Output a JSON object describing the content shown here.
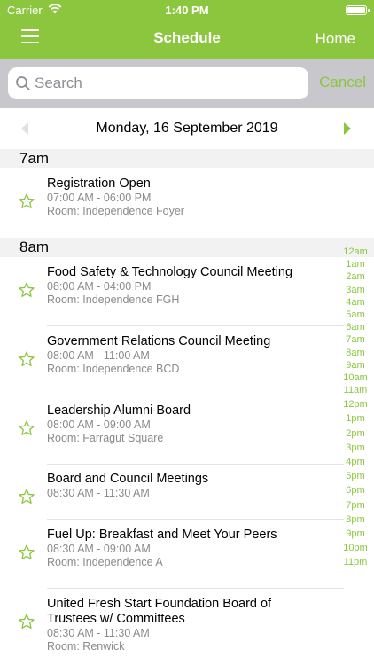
{
  "status_bar": {
    "carrier": "Carrier",
    "time": "1:40 PM"
  },
  "header": {
    "title": "Schedule",
    "home_label": "Home"
  },
  "search": {
    "placeholder": "Search",
    "cancel_label": "Cancel"
  },
  "date_nav": {
    "date": "Monday, 16 September 2019"
  },
  "sections": [
    {
      "label": "7am",
      "events": [
        {
          "title": "Registration Open",
          "time": "07:00 AM - 06:00 PM",
          "room": "Room: Independence Foyer"
        }
      ]
    },
    {
      "label": "8am",
      "events": [
        {
          "title": "Food Safety & Technology Council Meeting",
          "time": "08:00 AM - 04:00 PM",
          "room": "Room: Independence FGH"
        },
        {
          "title": "Government Relations Council Meeting",
          "time": "08:00 AM - 11:00 AM",
          "room": "Room: Independence BCD"
        },
        {
          "title": "Leadership Alumni Board",
          "time": "08:00 AM - 09:00 AM",
          "room": "Room: Farragut Square"
        },
        {
          "title": "Board and Council Meetings",
          "time": "08:30 AM - 11:30 AM",
          "room": ""
        },
        {
          "title": "Fuel Up: Breakfast and Meet Your Peers",
          "time": "08:30 AM - 09:00 AM",
          "room": "Room: Independence A"
        },
        {
          "title_line1": "United Fresh Start Foundation Board of",
          "title_line2": "Trustees w/ Committees",
          "time": "08:30 AM - 11:30 AM",
          "room": "Room: Renwick"
        }
      ]
    }
  ],
  "hour_index": [
    "12am",
    "1am",
    "2am",
    "3am",
    "4am",
    "5am",
    "6am",
    "7am",
    "8am",
    "9am",
    "10am",
    "11am",
    "12pm",
    "1pm",
    "2pm",
    "3pm",
    "4pm",
    "5pm",
    "6pm",
    "7pm",
    "8pm",
    "9pm",
    "10pm",
    "11pm"
  ],
  "colors": {
    "accent": "#8cc63f",
    "search_bg": "#c8c7cc",
    "section_bg": "#f2f2f2"
  },
  "icons": [
    "menu-icon",
    "search-icon",
    "chevron-left-icon",
    "chevron-right-icon",
    "star-icon",
    "wifi-icon",
    "battery-icon"
  ]
}
